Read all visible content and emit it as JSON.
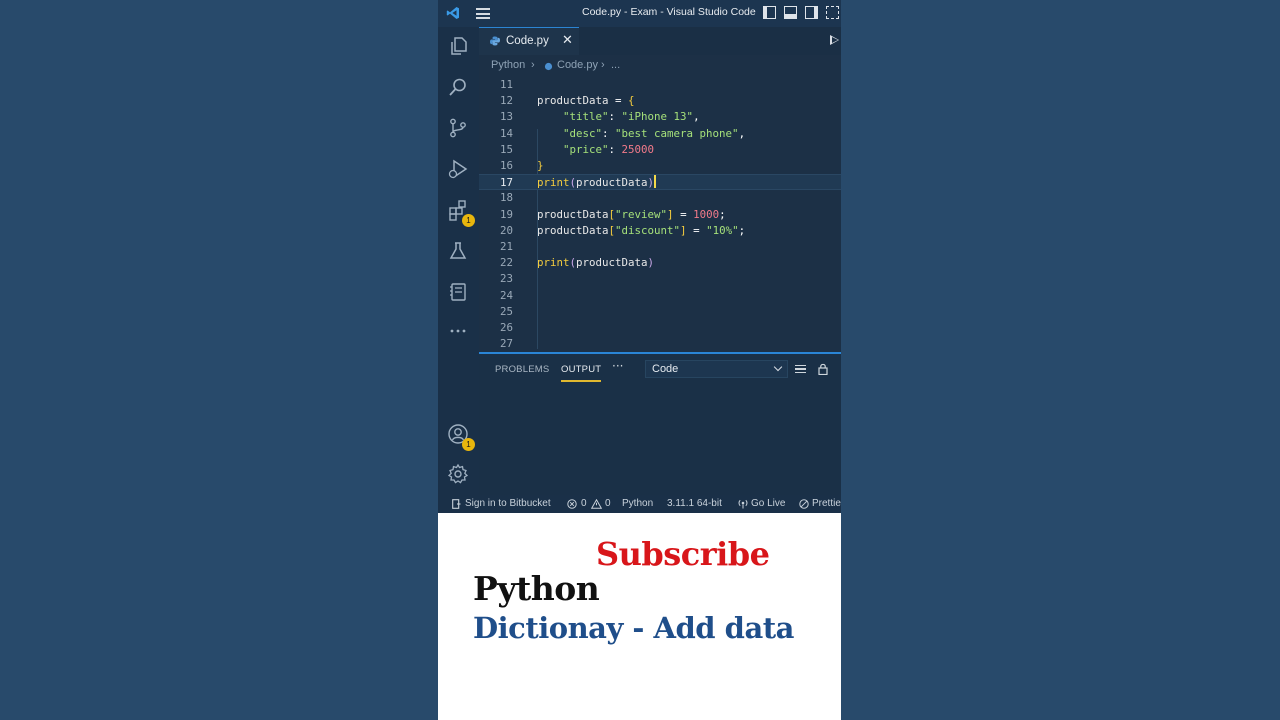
{
  "window": {
    "title": "Code.py - Exam - Visual Studio Code"
  },
  "activity_bar": {
    "extensions_badge": "1",
    "accounts_badge": "1"
  },
  "editor": {
    "tab_label": "Code.py",
    "tab_close": "✕",
    "breadcrumb": [
      "Python",
      "Code.py",
      "..."
    ],
    "lines": [
      {
        "num": "11",
        "segments": []
      },
      {
        "num": "12",
        "segments": [
          [
            "v",
            "productData"
          ],
          [
            "k",
            " = "
          ],
          [
            "p",
            "{"
          ]
        ]
      },
      {
        "num": "13",
        "segments": [
          [
            "v",
            "    "
          ],
          [
            "s",
            "\"title\""
          ],
          [
            "k",
            ": "
          ],
          [
            "s",
            "\"iPhone 13\""
          ],
          [
            "k",
            ","
          ]
        ]
      },
      {
        "num": "14",
        "segments": [
          [
            "v",
            "    "
          ],
          [
            "s",
            "\"desc\""
          ],
          [
            "k",
            ": "
          ],
          [
            "s",
            "\"best camera phone\""
          ],
          [
            "k",
            ","
          ]
        ]
      },
      {
        "num": "15",
        "segments": [
          [
            "v",
            "    "
          ],
          [
            "s",
            "\"price\""
          ],
          [
            "k",
            ": "
          ],
          [
            "n",
            "25000"
          ]
        ]
      },
      {
        "num": "16",
        "segments": [
          [
            "p",
            "}"
          ]
        ]
      },
      {
        "num": "17",
        "segments": [
          [
            "f",
            "print"
          ],
          [
            "d",
            "("
          ],
          [
            "v",
            "productData"
          ],
          [
            "d",
            ")"
          ]
        ],
        "current": true
      },
      {
        "num": "18",
        "segments": []
      },
      {
        "num": "19",
        "segments": [
          [
            "v",
            "productData"
          ],
          [
            "p",
            "["
          ],
          [
            "s",
            "\"review\""
          ],
          [
            "p",
            "]"
          ],
          [
            "k",
            " = "
          ],
          [
            "n",
            "1000"
          ],
          [
            "k",
            ";"
          ]
        ]
      },
      {
        "num": "20",
        "segments": [
          [
            "v",
            "productData"
          ],
          [
            "p",
            "["
          ],
          [
            "s",
            "\"discount\""
          ],
          [
            "p",
            "]"
          ],
          [
            "k",
            " = "
          ],
          [
            "s",
            "\"10%\""
          ],
          [
            "k",
            ";"
          ]
        ]
      },
      {
        "num": "21",
        "segments": []
      },
      {
        "num": "22",
        "segments": [
          [
            "f",
            "print"
          ],
          [
            "d",
            "("
          ],
          [
            "v",
            "productData"
          ],
          [
            "d",
            ")"
          ]
        ]
      },
      {
        "num": "23",
        "segments": []
      },
      {
        "num": "24",
        "segments": []
      },
      {
        "num": "25",
        "segments": []
      },
      {
        "num": "26",
        "segments": []
      },
      {
        "num": "27",
        "segments": []
      }
    ]
  },
  "panel": {
    "tabs": [
      "PROBLEMS",
      "OUTPUT"
    ],
    "active_tab": "OUTPUT",
    "more": "···",
    "output_channel": "Code"
  },
  "status_bar": {
    "bitbucket": "Sign in to Bitbucket",
    "errors": "0",
    "warnings": "0",
    "language": "Python",
    "interpreter": "3.11.1 64-bit",
    "go_live": "Go Live",
    "prettier": "Prettier"
  },
  "caption": {
    "subscribe": "Subscribe",
    "python": "Python",
    "topic": "Dictionay - Add data"
  },
  "colors": {
    "accent_blue": "#2a85d6",
    "active_tab_line": "#e0b82f",
    "subscribe_red": "#d8161a",
    "topic_blue": "#1f4e8a"
  }
}
